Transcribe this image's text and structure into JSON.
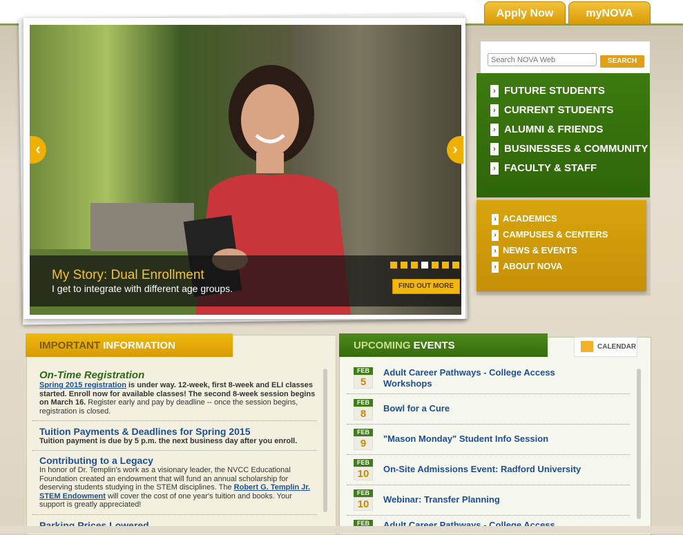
{
  "top_tabs": {
    "apply_label": "Apply Now",
    "mynova_label": "myNOVA"
  },
  "hero": {
    "title": "My Story: Dual Enrollment",
    "subtitle": "I get to integrate with different age groups.",
    "cta": "FIND OUT MORE",
    "slide_count": 7,
    "active_slide": 4,
    "prev_glyph": "‹",
    "next_glyph": "›"
  },
  "search": {
    "placeholder": "Search NOVA Web",
    "button_label": "SEARCH"
  },
  "audience_nav": [
    {
      "label": "FUTURE STUDENTS"
    },
    {
      "label": "CURRENT STUDENTS"
    },
    {
      "label": "ALUMNI & FRIENDS"
    },
    {
      "label": "BUSINESSES & COMMUNITY"
    },
    {
      "label": "FACULTY & STAFF"
    }
  ],
  "section_nav": [
    {
      "label": "ACADEMICS"
    },
    {
      "label": "CAMPUSES & CENTERS"
    },
    {
      "label": "NEWS & EVENTS"
    },
    {
      "label": "ABOUT NOVA"
    }
  ],
  "important_info": {
    "heading_dim": "IMPORTANT",
    "heading_bright": "INFORMATION",
    "items": [
      {
        "title": "On-Time Registration",
        "link": "Spring 2015 registration",
        "body_bold": " is under way. 12-week, first 8-week and ELI classes started. Enroll now for available classes! The second 8-week session begins on March 16.",
        "body_rest": " Register early and pay by deadline -- once the session begins, registration is closed."
      },
      {
        "title": "Tuition Payments & Deadlines for Spring 2015",
        "body": "Tuition payment is due by 5 p.m. the next business day after you enroll."
      },
      {
        "title": "Contributing to a Legacy",
        "body_pre": "In honor of Dr. Templin's work as a visionary leader, the NVCC Educational Foundation created an endowment that will fund an annual scholarship for deserving students studying in the STEM disciplines. The ",
        "link": "Robert G. Templin Jr. STEM Endowment",
        "body_post": " will cover the cost of one year's tuition and books. Your support is greatly appreciated!"
      },
      {
        "title": "Parking Prices Lowered"
      }
    ]
  },
  "events": {
    "heading_dim": "UPCOMING",
    "heading_bright": "EVENTS",
    "calendar_label": "CALENDAR",
    "items": [
      {
        "month": "FEB",
        "day": "5",
        "title": "Adult Career Pathways - College Access Workshops"
      },
      {
        "month": "FEB",
        "day": "8",
        "title": "Bowl for a Cure"
      },
      {
        "month": "FEB",
        "day": "9",
        "title": "\"Mason Monday\" Student Info Session"
      },
      {
        "month": "FEB",
        "day": "10",
        "title": "On-Site Admissions Event: Radford University"
      },
      {
        "month": "FEB",
        "day": "10",
        "title": "Webinar: Transfer Planning"
      },
      {
        "month": "FEB",
        "day": "",
        "title": "Adult Career Pathways - College Access"
      }
    ]
  }
}
